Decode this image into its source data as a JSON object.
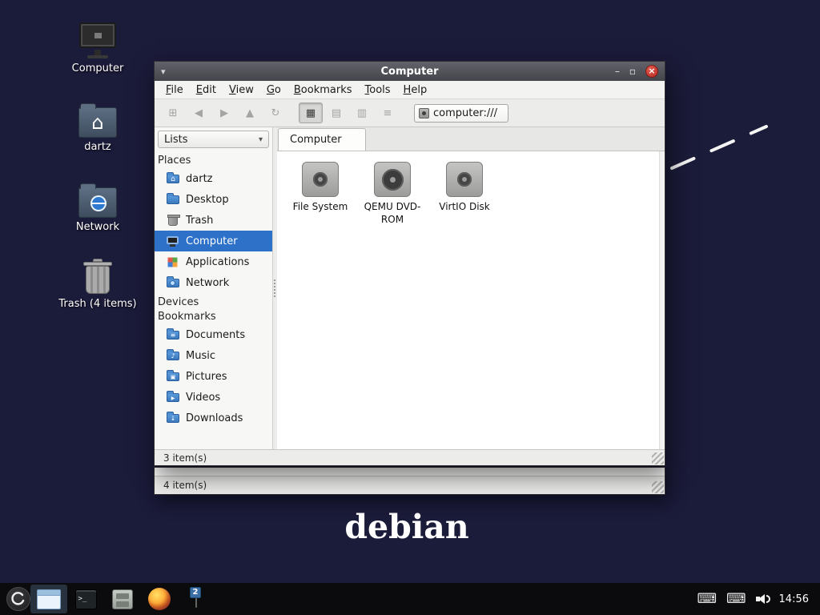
{
  "icons": {
    "titlebar_menu_chevron": "▾",
    "minimize": "–",
    "maximize": "▫",
    "close": "×",
    "new_tab": "⊞",
    "back": "◀",
    "forward": "▶",
    "up": "▲",
    "reload": "↻",
    "view_icons": "▦",
    "view_thumbnails": "▤",
    "view_compact": "▥",
    "view_detailed": "≡",
    "combo_arrow": "▾",
    "keyboard": "⌨"
  },
  "desktop": {
    "logo_text": "debian",
    "icons": [
      {
        "label": "Computer",
        "icon": "computer-icon"
      },
      {
        "label": "dartz",
        "icon": "home-folder-icon"
      },
      {
        "label": "Network",
        "icon": "network-folder-icon"
      },
      {
        "label": "Trash (4 items)",
        "icon": "trash-icon"
      }
    ]
  },
  "window": {
    "title": "Computer",
    "menu": [
      "File",
      "Edit",
      "View",
      "Go",
      "Bookmarks",
      "Tools",
      "Help"
    ],
    "path_value": "computer:///",
    "tab_label": "Computer",
    "status": "3 item(s)",
    "sidebar": {
      "view_mode": "Lists",
      "places_label": "Places",
      "devices_label": "Devices",
      "bookmarks_label": "Bookmarks",
      "places": [
        {
          "label": "dartz",
          "icon": "user-home-folder-icon"
        },
        {
          "label": "Desktop",
          "icon": "desktop-folder-icon"
        },
        {
          "label": "Trash",
          "icon": "trash-icon"
        },
        {
          "label": "Computer",
          "icon": "computer-icon",
          "selected": true
        },
        {
          "label": "Applications",
          "icon": "applications-icon"
        },
        {
          "label": "Network",
          "icon": "network-icon"
        }
      ],
      "bookmarks": [
        {
          "label": "Documents",
          "icon": "documents-folder-icon"
        },
        {
          "label": "Music",
          "icon": "music-folder-icon"
        },
        {
          "label": "Pictures",
          "icon": "pictures-folder-icon"
        },
        {
          "label": "Videos",
          "icon": "videos-folder-icon"
        },
        {
          "label": "Downloads",
          "icon": "downloads-folder-icon"
        }
      ]
    },
    "files": [
      {
        "label": "File System",
        "icon": "hard-drive-icon"
      },
      {
        "label": "QEMU DVD-ROM",
        "icon": "optical-drive-icon"
      },
      {
        "label": "VirtIO Disk",
        "icon": "hard-drive-icon"
      }
    ]
  },
  "background_window": {
    "status": "4 item(s)"
  },
  "taskbar": {
    "time": "14:56",
    "window_count_badge": "2"
  }
}
